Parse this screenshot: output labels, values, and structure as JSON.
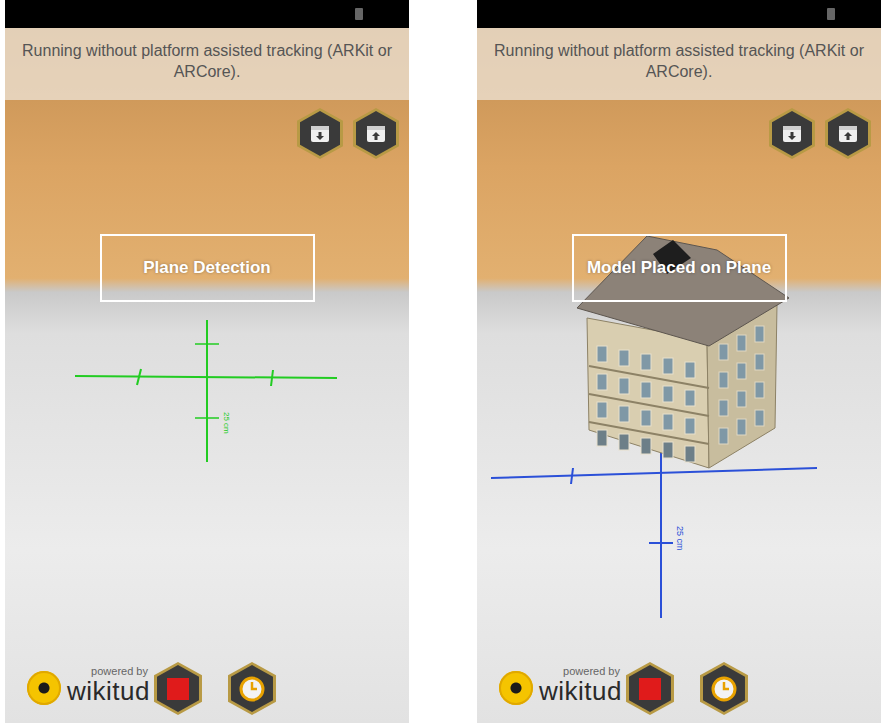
{
  "screens": [
    {
      "banner": "Running without platform assisted tracking (ARKit or ARCore).",
      "label": "Plane Detection",
      "axes": {
        "color": "#22cc22",
        "label": "25 cm"
      },
      "model_visible": false,
      "footer": {
        "powered_by": "powered by",
        "logo": "wikitud"
      }
    },
    {
      "banner": "Running without platform assisted tracking (ARKit or ARCore).",
      "label": "Model Placed on Plane",
      "axes": {
        "color": "#2b50d8",
        "label": "25 cm"
      },
      "model_visible": true,
      "footer": {
        "powered_by": "powered by",
        "logo": "wikitud"
      }
    }
  ]
}
